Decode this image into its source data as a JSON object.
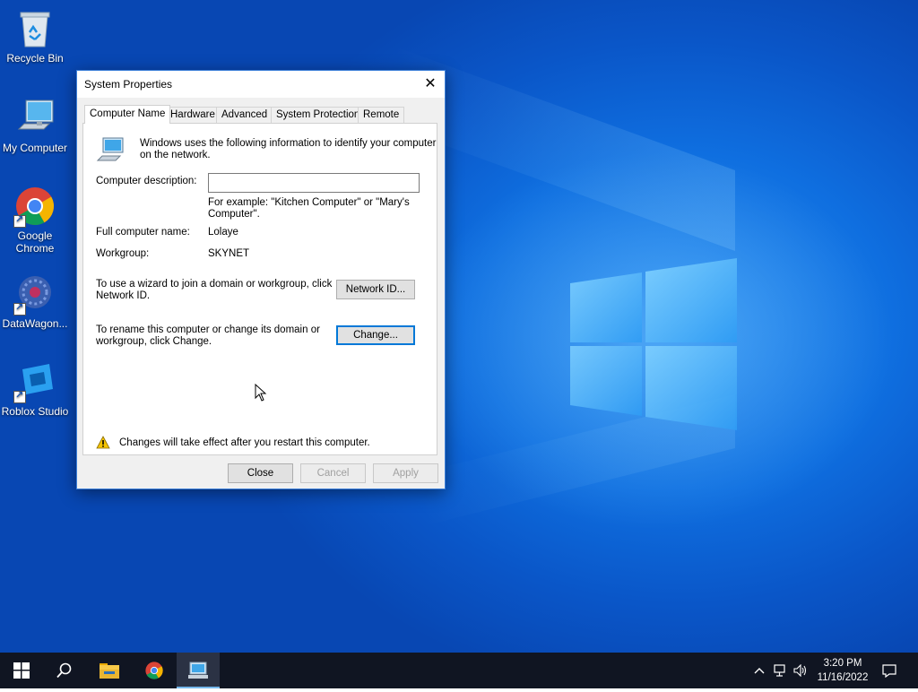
{
  "desktop": {
    "icons": [
      {
        "label": "Recycle Bin"
      },
      {
        "label": "My Computer"
      },
      {
        "label": "Google Chrome"
      },
      {
        "label": "DataWagon..."
      },
      {
        "label": "Roblox Studio"
      }
    ]
  },
  "dialog": {
    "title": "System Properties",
    "tabs": [
      {
        "label": "Computer Name",
        "active": true
      },
      {
        "label": "Hardware"
      },
      {
        "label": "Advanced"
      },
      {
        "label": "System Protection"
      },
      {
        "label": "Remote"
      }
    ],
    "intro_line1": "Windows uses the following information to identify your computer",
    "intro_line2": "on the network.",
    "description_label": "Computer description:",
    "description_value": "",
    "example_line1": "For example: \"Kitchen Computer\" or \"Mary's",
    "example_line2": "Computer\".",
    "full_name_label": "Full computer name:",
    "full_name_value": "Lolaye",
    "workgroup_label": "Workgroup:",
    "workgroup_value": "SKYNET",
    "wizard_line1": "To use a wizard to join a domain or workgroup, click",
    "wizard_line2": "Network ID.",
    "network_id_button": "Network ID...",
    "rename_line1": "To rename this computer or change its domain or",
    "rename_line2": "workgroup, click Change.",
    "change_button": "Change...",
    "restart_warning": "Changes will take effect after you restart this computer.",
    "close_button": "Close",
    "cancel_button": "Cancel",
    "apply_button": "Apply"
  },
  "taskbar": {
    "time": "3:20 PM",
    "date": "11/16/2022"
  },
  "colors": {
    "accent": "#0078d7",
    "taskbar": "#101522",
    "desktop": "#0a56c8"
  }
}
